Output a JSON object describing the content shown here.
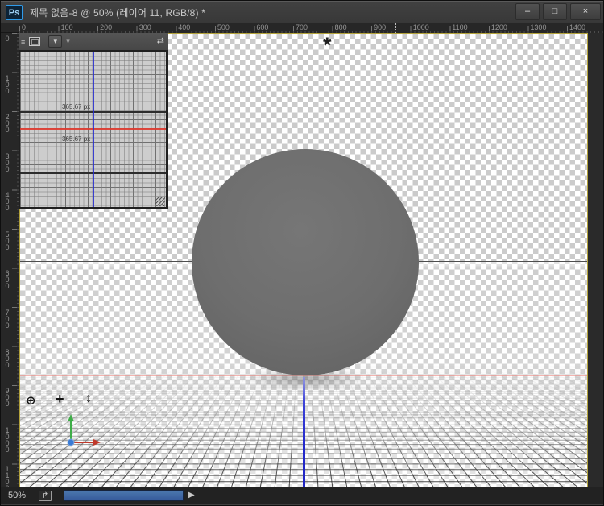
{
  "window": {
    "app_badge": "Ps",
    "title": "제목 없음-8 @ 50% (레이어 11, RGB/8) *",
    "controls": {
      "minimize": "–",
      "maximize": "□",
      "close": "×"
    }
  },
  "rulers": {
    "top": [
      "0",
      "100",
      "200",
      "300",
      "400",
      "500",
      "600",
      "700",
      "800",
      "900",
      "1000",
      "1100",
      "1200",
      "1300",
      "1400"
    ],
    "left": [
      "0",
      "100",
      "200",
      "300",
      "400",
      "500",
      "600",
      "700",
      "800",
      "900",
      "1000",
      "1100"
    ]
  },
  "secondary_view": {
    "measure_top": "365.67 px",
    "measure_bottom": "365.67 px",
    "menu_glyph": "≡",
    "dropdown_glyph": "▾",
    "caret_glyph": "▾",
    "expand_glyph": "⇄"
  },
  "canvas": {
    "light_icon_glyph": "*"
  },
  "tools3d": {
    "orbit_glyph": "⊕",
    "pan_glyph": "+",
    "slide_glyph": "↕"
  },
  "status_bar": {
    "zoom_level": "50%",
    "export_icon_glyph": "↱",
    "scroll_arrow": "▶"
  },
  "colors": {
    "accent_blue": "#2f9bea",
    "outline_yellow": "#b3a23b",
    "scrollbar_blue": "#3d6ca8",
    "guide_red": "#e0382e",
    "guide_blue": "#2a30d0",
    "guide_pink": "#f28c86",
    "axis_x_red": "#c0392b",
    "axis_y_green": "#3fae49",
    "axis_z_blue": "#3a7bd5",
    "sphere_gray": "#6e6e6e"
  }
}
